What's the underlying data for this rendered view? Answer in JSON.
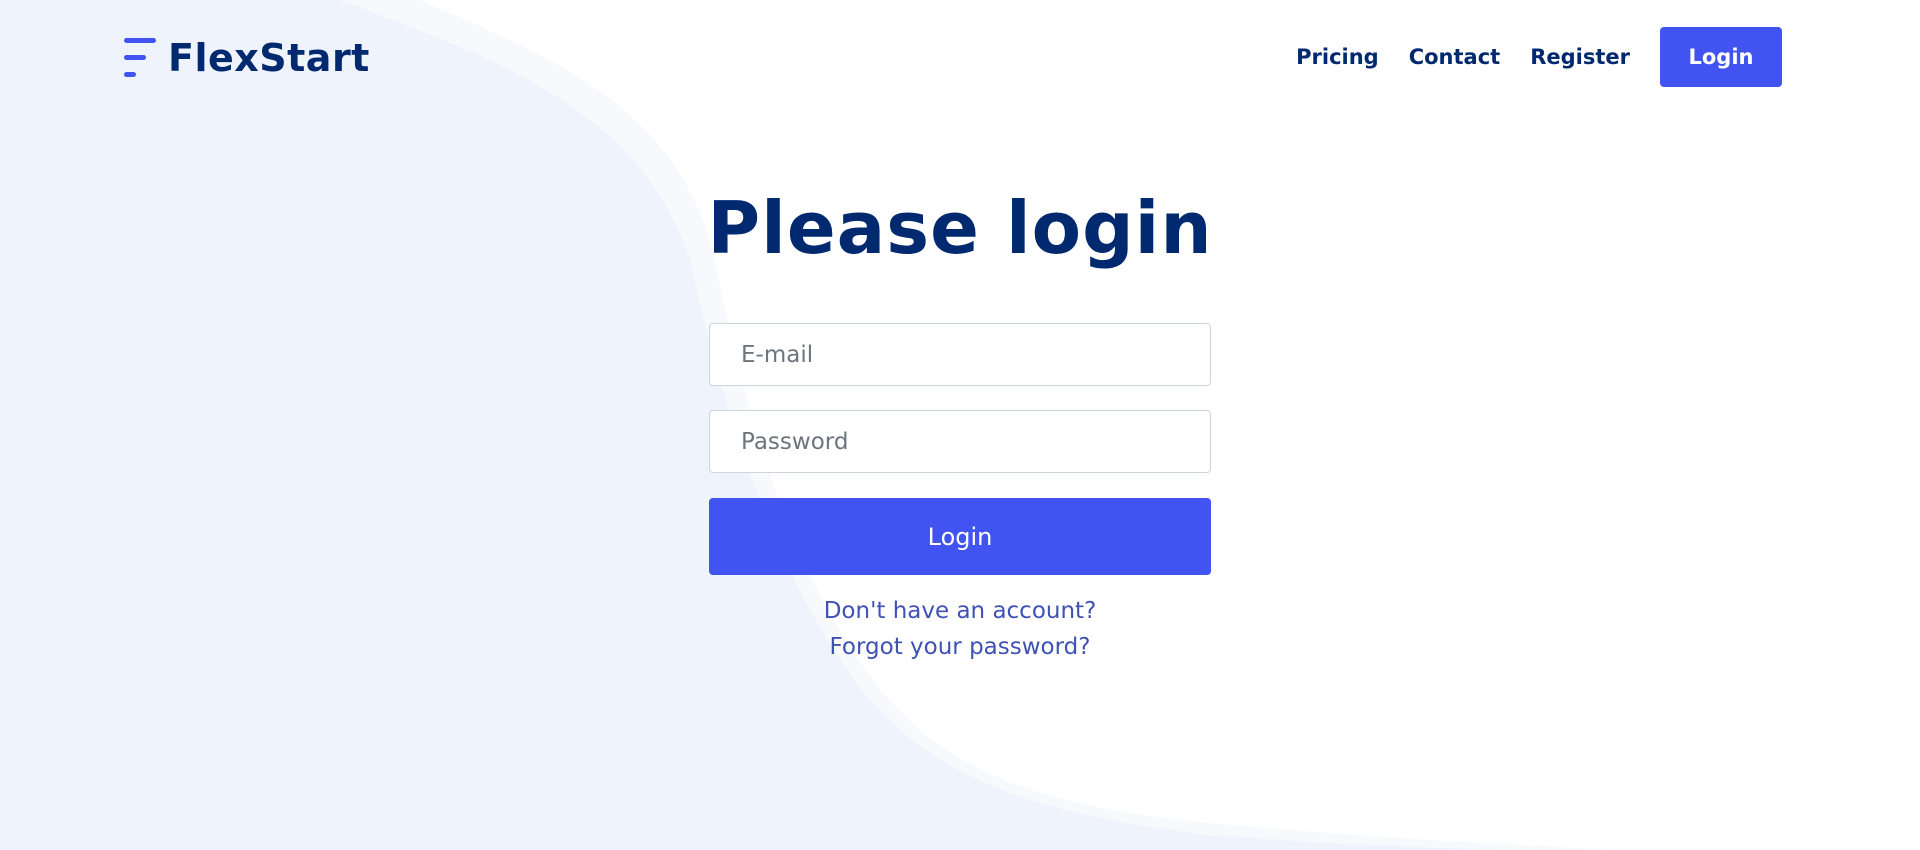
{
  "brand": {
    "name": "FlexStart"
  },
  "nav": {
    "items": [
      {
        "label": "Pricing"
      },
      {
        "label": "Contact"
      },
      {
        "label": "Register"
      }
    ],
    "login_label": "Login"
  },
  "login": {
    "title": "Please login",
    "email_placeholder": "E-mail",
    "email_value": "",
    "password_placeholder": "Password",
    "password_value": "",
    "submit_label": "Login",
    "register_link": "Don't have an account?",
    "forgot_link": "Forgot your password?"
  },
  "colors": {
    "primary": "#4154f1",
    "heading": "#012970",
    "link": "#3f51b5",
    "background_shape": "#eff3fb"
  }
}
